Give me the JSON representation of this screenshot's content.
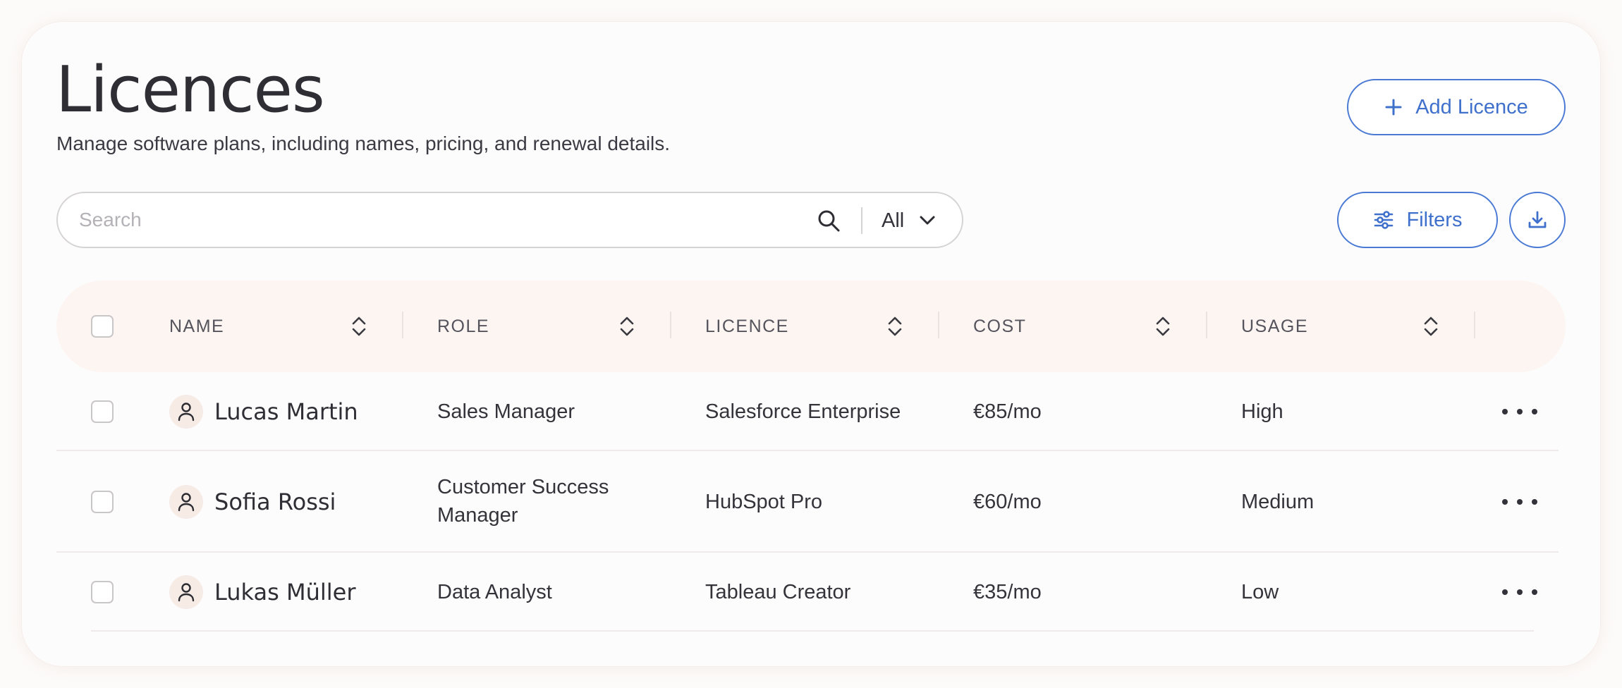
{
  "header": {
    "title": "Licences",
    "subtitle": "Manage software plans, including names, pricing, and renewal details.",
    "add_button": "Add Licence"
  },
  "toolbar": {
    "search_placeholder": "Search",
    "scope_value": "All",
    "filters_button": "Filters"
  },
  "table": {
    "columns": [
      "NAME",
      "ROLE",
      "LICENCE",
      "COST",
      "USAGE"
    ],
    "rows": [
      {
        "name": "Lucas Martin",
        "role": [
          "Sales Manager"
        ],
        "licence": "Salesforce Enterprise",
        "cost": "€85/mo",
        "usage": "High"
      },
      {
        "name": "Sofia Rossi",
        "role": [
          "Customer Success",
          "Manager"
        ],
        "licence": "HubSpot Pro",
        "cost": "€60/mo",
        "usage": "Medium"
      },
      {
        "name": "Lukas Müller",
        "role": [
          "Data Analyst"
        ],
        "licence": "Tableau Creator",
        "cost": "€35/mo",
        "usage": "Low"
      }
    ]
  },
  "colors": {
    "accent": "#3f70cc",
    "header_row_bg": "#fcf5f2",
    "avatar_bg": "#f7ebe6"
  },
  "icons": [
    "plus-icon",
    "search-icon",
    "chevron-down-icon",
    "sliders-icon",
    "download-icon",
    "sort-icon",
    "user-icon",
    "more-horizontal-icon"
  ]
}
